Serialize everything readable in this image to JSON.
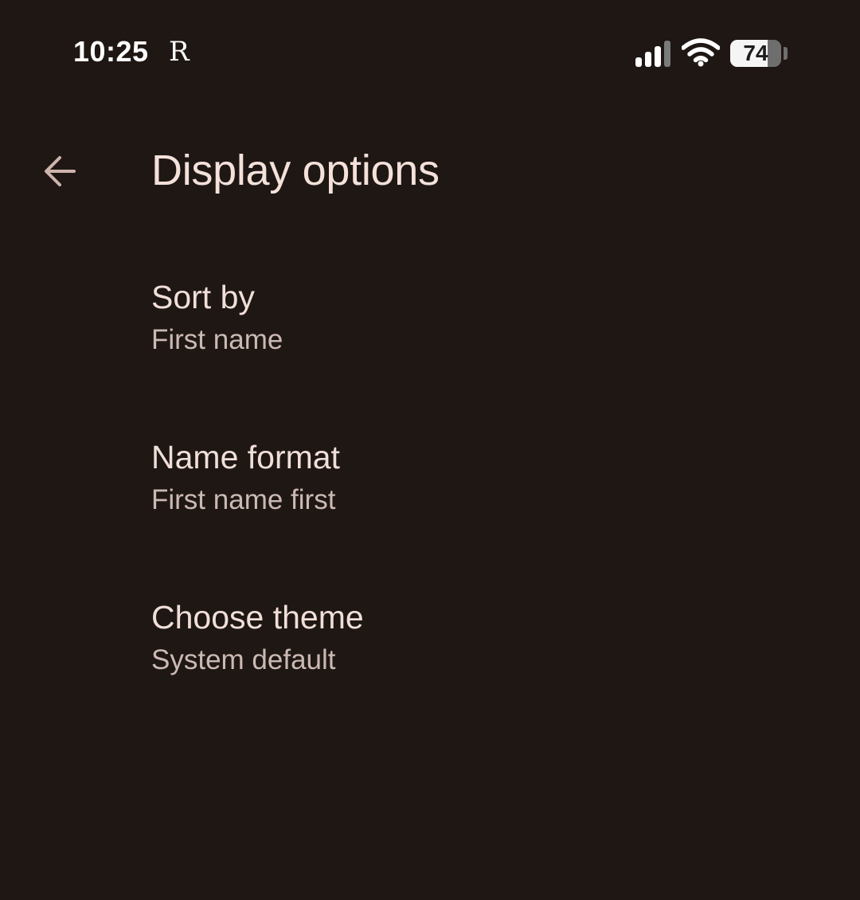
{
  "status_bar": {
    "time": "10:25",
    "carrier_glyph": "R",
    "battery_level": 74,
    "battery_label": "74",
    "icons": [
      "signal-icon",
      "wifi-icon",
      "battery-icon"
    ]
  },
  "app_bar": {
    "back_icon": "arrow-back-icon",
    "title": "Display options"
  },
  "options": [
    {
      "title": "Sort by",
      "value": "First name"
    },
    {
      "title": "Name format",
      "value": "First name first"
    },
    {
      "title": "Choose theme",
      "value": "System default"
    }
  ],
  "colors": {
    "background": "#1f1714",
    "title_text": "#f3e1da",
    "secondary_text": "#cbbab3",
    "back_arrow": "#cdb4ac"
  }
}
